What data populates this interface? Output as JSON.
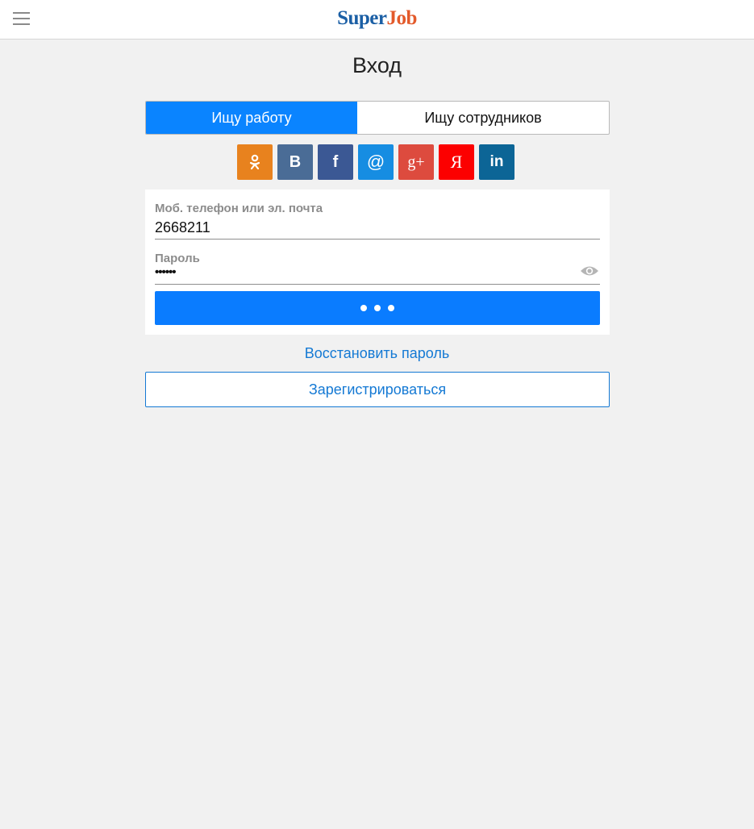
{
  "header": {
    "logo_part1": "Super",
    "logo_part2": "Job"
  },
  "page": {
    "title": "Вход"
  },
  "role_tabs": [
    {
      "label": "Ищу работу",
      "active": true
    },
    {
      "label": "Ищу сотрудников",
      "active": false
    }
  ],
  "social": [
    {
      "name": "odnoklassniki",
      "glyph": "ok-icon",
      "color": "#e8821e"
    },
    {
      "name": "vkontakte",
      "glyph": "В",
      "color": "#4a6c96"
    },
    {
      "name": "facebook",
      "glyph": "f",
      "color": "#3b5894"
    },
    {
      "name": "mailru",
      "glyph": "@",
      "color": "#168de2"
    },
    {
      "name": "googleplus",
      "glyph": "g+",
      "color": "#dd4b3e"
    },
    {
      "name": "yandex",
      "glyph": "Я",
      "color": "#fc0000"
    },
    {
      "name": "linkedin",
      "glyph": "in",
      "color": "#0c6596"
    }
  ],
  "form": {
    "login_label": "Моб. телефон или эл. почта",
    "login_value": "2668211",
    "password_label": "Пароль",
    "password_value": "••••••"
  },
  "links": {
    "restore": "Восстановить пароль",
    "register": "Зарегистрироваться"
  },
  "colors": {
    "accent": "#0a84ff",
    "link": "#1479d4",
    "background": "#f1f1f1"
  }
}
